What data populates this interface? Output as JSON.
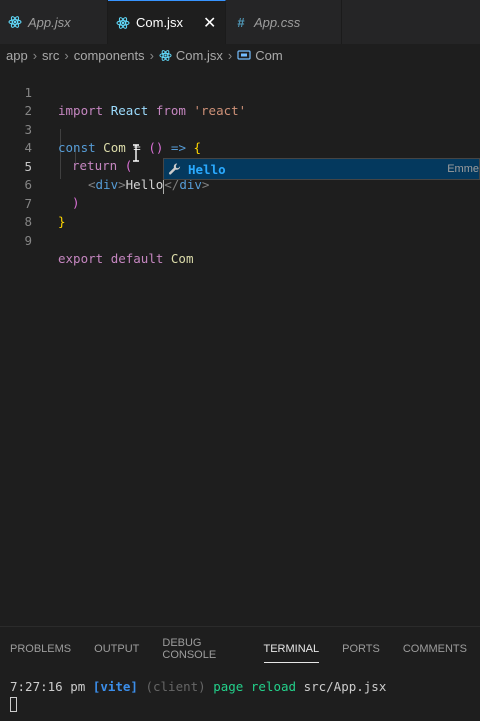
{
  "tabs": [
    {
      "label": "App.jsx",
      "icon": "react-icon",
      "italic": true,
      "active": false
    },
    {
      "label": "Com.jsx",
      "icon": "react-icon",
      "italic": false,
      "active": true,
      "close": "✕"
    },
    {
      "label": "App.css",
      "icon": "hash-icon",
      "icon_glyph": "#",
      "italic": true,
      "active": false
    }
  ],
  "breadcrumb": {
    "items": [
      "app",
      "src",
      "components",
      "Com.jsx",
      "Com"
    ],
    "separator": "›"
  },
  "editor": {
    "line_numbers": [
      "1",
      "2",
      "3",
      "4",
      "5",
      "6",
      "7",
      "8",
      "9"
    ],
    "current_line": 5,
    "l1": {
      "kw1": "import",
      "id": "React",
      "kw2": "from",
      "str": "'react'"
    },
    "l3": {
      "kw": "const",
      "name": "Com",
      "eq": " = ",
      "paren": "()",
      "arrow": " => ",
      "brace": "{"
    },
    "l4": {
      "kw": "return",
      "paren": "("
    },
    "l5": {
      "open_lt": "<",
      "open_tag": "div",
      "open_gt": ">",
      "text_before": "He",
      "text_after": "llo",
      "close_lt": "</",
      "close_tag": "div",
      "close_gt": ">"
    },
    "l6": {
      "paren": ")"
    },
    "l7": {
      "brace": "}"
    },
    "l9": {
      "kw1": "export",
      "kw2": "default",
      "name": "Com"
    }
  },
  "suggest": {
    "label": "Hello",
    "detail": "Emme",
    "icon": "wrench-icon"
  },
  "panel": {
    "tabs": [
      "PROBLEMS",
      "OUTPUT",
      "DEBUG CONSOLE",
      "TERMINAL",
      "PORTS",
      "COMMENTS"
    ],
    "active": "TERMINAL",
    "terminal": {
      "time": "7:27:16 pm",
      "tag": "[vite]",
      "client": "(client)",
      "msg": "page reload",
      "file": "src/App.jsx"
    }
  },
  "colors": {
    "accent": "#3794ff",
    "suggest_bg": "#04395e",
    "suggest_text": "#2aaaff",
    "editor_bg": "#1e1e1e"
  }
}
